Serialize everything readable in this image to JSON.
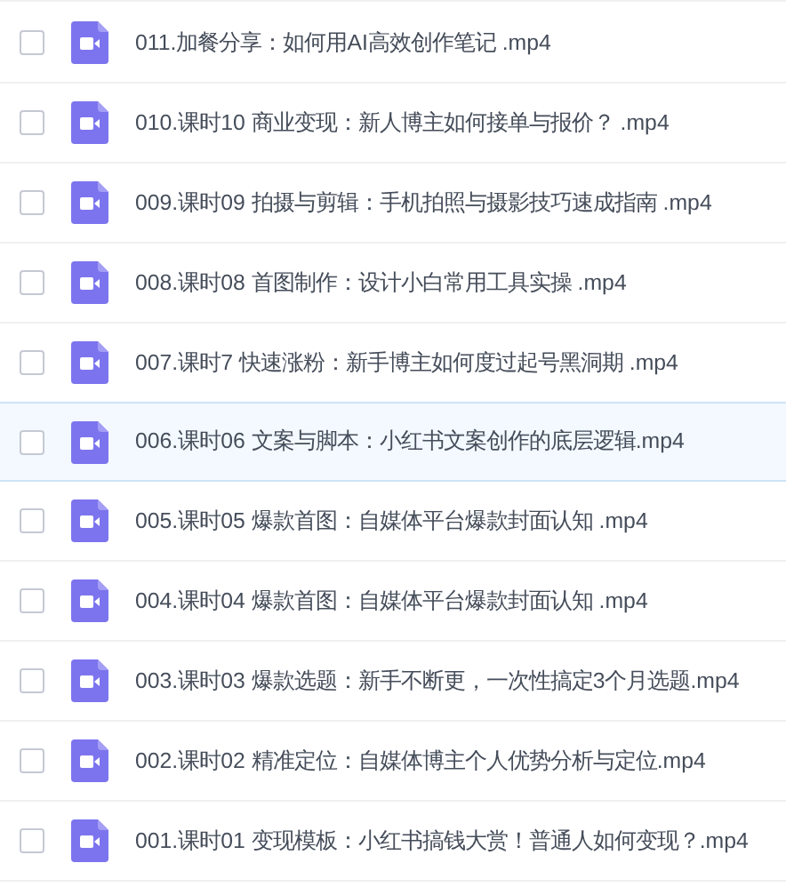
{
  "files": [
    {
      "name": "011.加餐分享：如何用AI高效创作笔记 .mp4",
      "checked": false,
      "highlighted": false
    },
    {
      "name": "010.课时10 商业变现：新人博主如何接单与报价？ .mp4",
      "checked": false,
      "highlighted": false
    },
    {
      "name": "009.课时09 拍摄与剪辑：手机拍照与摄影技巧速成指南 .mp4",
      "checked": false,
      "highlighted": false
    },
    {
      "name": "008.课时08 首图制作：设计小白常用工具实操 .mp4",
      "checked": false,
      "highlighted": false
    },
    {
      "name": "007.课时7 快速涨粉：新手博主如何度过起号黑洞期 .mp4",
      "checked": false,
      "highlighted": false
    },
    {
      "name": "006.课时06 文案与脚本：小红书文案创作的底层逻辑.mp4",
      "checked": false,
      "highlighted": true
    },
    {
      "name": "005.课时05 爆款首图：自媒体平台爆款封面认知 .mp4",
      "checked": false,
      "highlighted": false
    },
    {
      "name": "004.课时04 爆款首图：自媒体平台爆款封面认知 .mp4",
      "checked": false,
      "highlighted": false
    },
    {
      "name": "003.课时03 爆款选题：新手不断更，一次性搞定3个月选题.mp4",
      "checked": false,
      "highlighted": false
    },
    {
      "name": "002.课时02 精准定位：自媒体博主个人优势分析与定位.mp4",
      "checked": false,
      "highlighted": false
    },
    {
      "name": "001.课时01 变现模板：小红书搞钱大赏！普通人如何变现？.mp4",
      "checked": false,
      "highlighted": false
    }
  ]
}
